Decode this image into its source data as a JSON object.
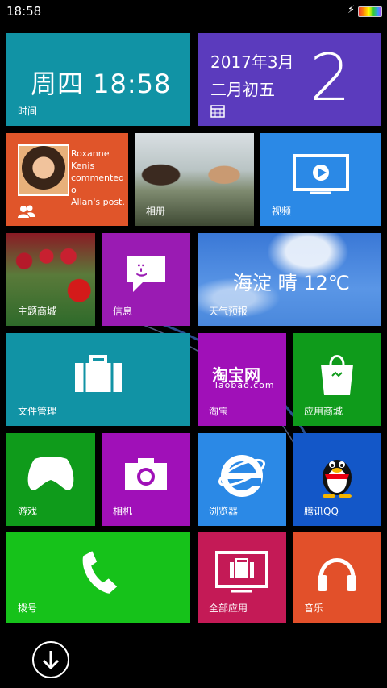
{
  "status": {
    "time": "18:58",
    "charging_icon": "lightning-icon",
    "battery_icon": "battery-icon"
  },
  "tiles": {
    "clock": {
      "display": "周四  18:58",
      "label": "时间",
      "color": "#1193a5"
    },
    "calendar": {
      "date": "2017年3月",
      "lunar": "二月初五",
      "day": "2",
      "icon": "calendar-icon",
      "color": "#5b3bbd"
    },
    "people": {
      "message_line1": "Roxanne Kenis",
      "message_line2": "commented o",
      "message_line3": "Allan's post.",
      "icon": "people-icon",
      "color": "#e0552a"
    },
    "photos": {
      "label": "相册"
    },
    "video": {
      "label": "视频",
      "icon": "video-play-icon",
      "color": "#2b89e6"
    },
    "themes": {
      "label": "主题商城"
    },
    "messages": {
      "label": "信息",
      "emoticon": ":-)",
      "icon": "message-icon",
      "color": "#9a1bb3"
    },
    "weather": {
      "text": "海淀 晴 12℃",
      "label": "天气预报"
    },
    "files": {
      "label": "文件管理",
      "icon": "briefcase-icon",
      "color": "#1193a5"
    },
    "taobao": {
      "logo": "淘宝网",
      "sub": "Taobao.com",
      "label": "淘宝",
      "color": "#a010b8"
    },
    "store": {
      "label": "应用商城",
      "icon": "shopping-bag-icon",
      "color": "#0f9b1b"
    },
    "games": {
      "label": "游戏",
      "icon": "xbox-controller-icon",
      "color": "#0f9b1b"
    },
    "camera": {
      "label": "相机",
      "icon": "camera-icon",
      "color": "#a010b8"
    },
    "browser": {
      "label": "浏览器",
      "icon": "ie-browser-icon",
      "color": "#2b89e6"
    },
    "qq": {
      "label": "腾讯QQ",
      "icon": "qq-penguin-icon",
      "color": "#1357c8"
    },
    "dialer": {
      "label": "拨号",
      "icon": "phone-handset-icon",
      "color": "#16c21a"
    },
    "allapps": {
      "label": "全部应用",
      "icon": "app-store-icon",
      "color": "#c41a56"
    },
    "music": {
      "label": "音乐",
      "icon": "headphones-icon",
      "color": "#e2502a"
    }
  },
  "bottom": {
    "icon": "arrow-down-icon"
  }
}
